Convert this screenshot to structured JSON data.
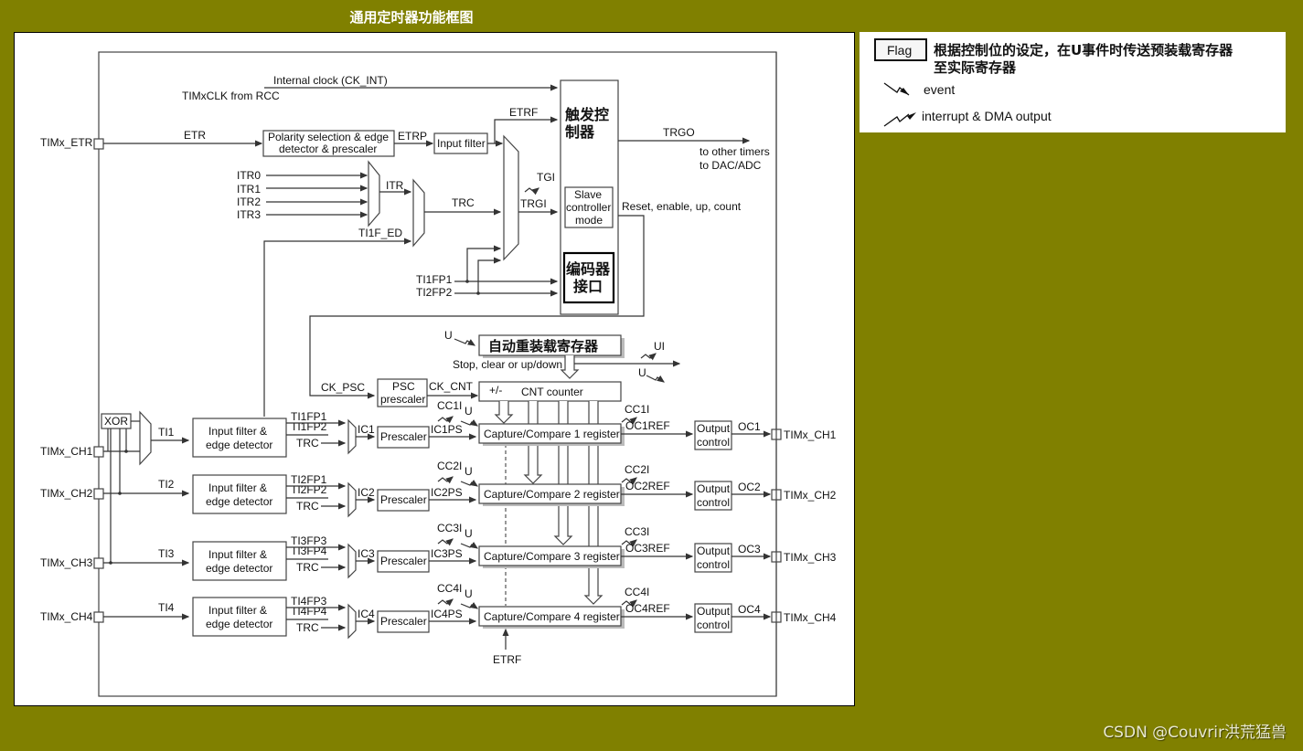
{
  "page": {
    "title": "通用定时器功能框图",
    "watermark": "CSDN @Couvrir洪荒猛兽",
    "background_color": "#808000"
  },
  "legend": {
    "flag_label": "Flag",
    "flag_desc_line1": "根据控制位的设定，在U事件时传送预装载寄存器",
    "flag_desc_line2": "至实际寄存器",
    "event_label": "event",
    "interrupt_label": "interrupt & DMA output"
  },
  "diagram": {
    "internal_clock": "Internal clock (CK_INT)",
    "timxclk": "TIMxCLK from RCC",
    "etr_pin": "TIMx_ETR",
    "etr": "ETR",
    "polarity_box_line1": "Polarity selection & edge",
    "polarity_box_line2": "detector & prescaler",
    "etrp": "ETRP",
    "input_filter": "Input filter",
    "etrf": "ETRF",
    "itr": [
      "ITR0",
      "ITR1",
      "ITR2",
      "ITR3"
    ],
    "itr_out": "ITR",
    "trc": "TRC",
    "ti1f_ed": "TI1F_ED",
    "tgi": "TGI",
    "trgi": "TRGI",
    "ti1fp1": "TI1FP1",
    "ti2fp2": "TI2FP2",
    "trigger_controller_line1": "触发控",
    "trigger_controller_line2": "制器",
    "slave_line1": "Slave",
    "slave_line2": "controller",
    "slave_line3": "mode",
    "encoder_line1": "编码器",
    "encoder_line2": "接口",
    "trgo": "TRGO",
    "to_other_timers": "to other timers",
    "to_dac_adc": "to DAC/ADC",
    "reset_enable": "Reset, enable, up, count",
    "u": "U",
    "ui": "UI",
    "auto_reload": "自动重装载寄存器",
    "stop_clear": "Stop, clear or up/down",
    "ck_psc": "CK_PSC",
    "psc_line1": "PSC",
    "psc_line2": "prescaler",
    "ck_cnt": "CK_CNT",
    "plus_minus": "+/-",
    "cnt_counter": "CNT counter",
    "xor": "XOR",
    "etrf_bottom": "ETRF",
    "input_filter_line1": "Input filter &",
    "input_filter_line2": "edge detector",
    "prescaler": "Prescaler",
    "output_line1": "Output",
    "output_line2": "control",
    "channels": [
      {
        "pin": "TIMx_CH1",
        "ti": "TI1",
        "fpa": "TI1FP1",
        "fpb": "TI1FP2",
        "trc": "TRC",
        "ic": "IC1",
        "icps": "IC1PS",
        "cci": "CC1I",
        "ccr": "Capture/Compare 1 register",
        "ocref": "OC1REF",
        "oc": "OC1"
      },
      {
        "pin": "TIMx_CH2",
        "ti": "TI2",
        "fpa": "TI2FP1",
        "fpb": "TI2FP2",
        "trc": "TRC",
        "ic": "IC2",
        "icps": "IC2PS",
        "cci": "CC2I",
        "ccr": "Capture/Compare 2 register",
        "ocref": "OC2REF",
        "oc": "OC2"
      },
      {
        "pin": "TIMx_CH3",
        "ti": "TI3",
        "fpa": "TI3FP3",
        "fpb": "TI3FP4",
        "trc": "TRC",
        "ic": "IC3",
        "icps": "IC3PS",
        "cci": "CC3I",
        "ccr": "Capture/Compare 3 register",
        "ocref": "OC3REF",
        "oc": "OC3"
      },
      {
        "pin": "TIMx_CH4",
        "ti": "TI4",
        "fpa": "TI4FP3",
        "fpb": "TI4FP4",
        "trc": "TRC",
        "ic": "IC4",
        "icps": "IC4PS",
        "cci": "CC4I",
        "ccr": "Capture/Compare 4 register",
        "ocref": "OC4REF",
        "oc": "OC4"
      }
    ]
  }
}
